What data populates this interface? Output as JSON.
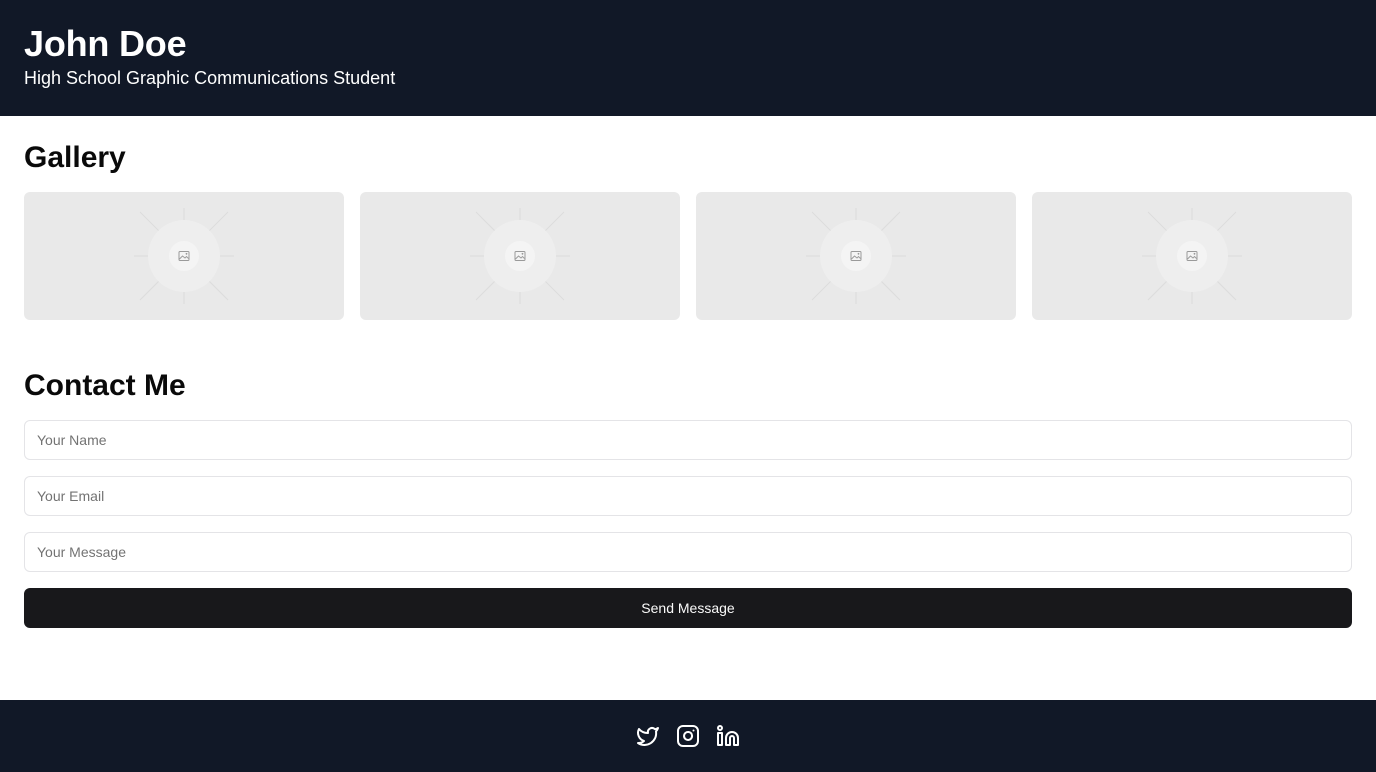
{
  "header": {
    "name": "John Doe",
    "tagline": "High School Graphic Communications Student"
  },
  "gallery": {
    "title": "Gallery",
    "items": [
      {
        "icon": "image-placeholder-icon"
      },
      {
        "icon": "image-placeholder-icon"
      },
      {
        "icon": "image-placeholder-icon"
      },
      {
        "icon": "image-placeholder-icon"
      }
    ]
  },
  "contact": {
    "title": "Contact Me",
    "name_placeholder": "Your Name",
    "email_placeholder": "Your Email",
    "message_placeholder": "Your Message",
    "name_value": "",
    "email_value": "",
    "message_value": "",
    "submit_label": "Send Message"
  },
  "footer": {
    "social": [
      "twitter-icon",
      "instagram-icon",
      "linkedin-icon"
    ]
  },
  "colors": {
    "header_bg": "#111827",
    "footer_bg": "#111827",
    "button_bg": "#18181b",
    "tile_bg": "#e9e9e9"
  }
}
